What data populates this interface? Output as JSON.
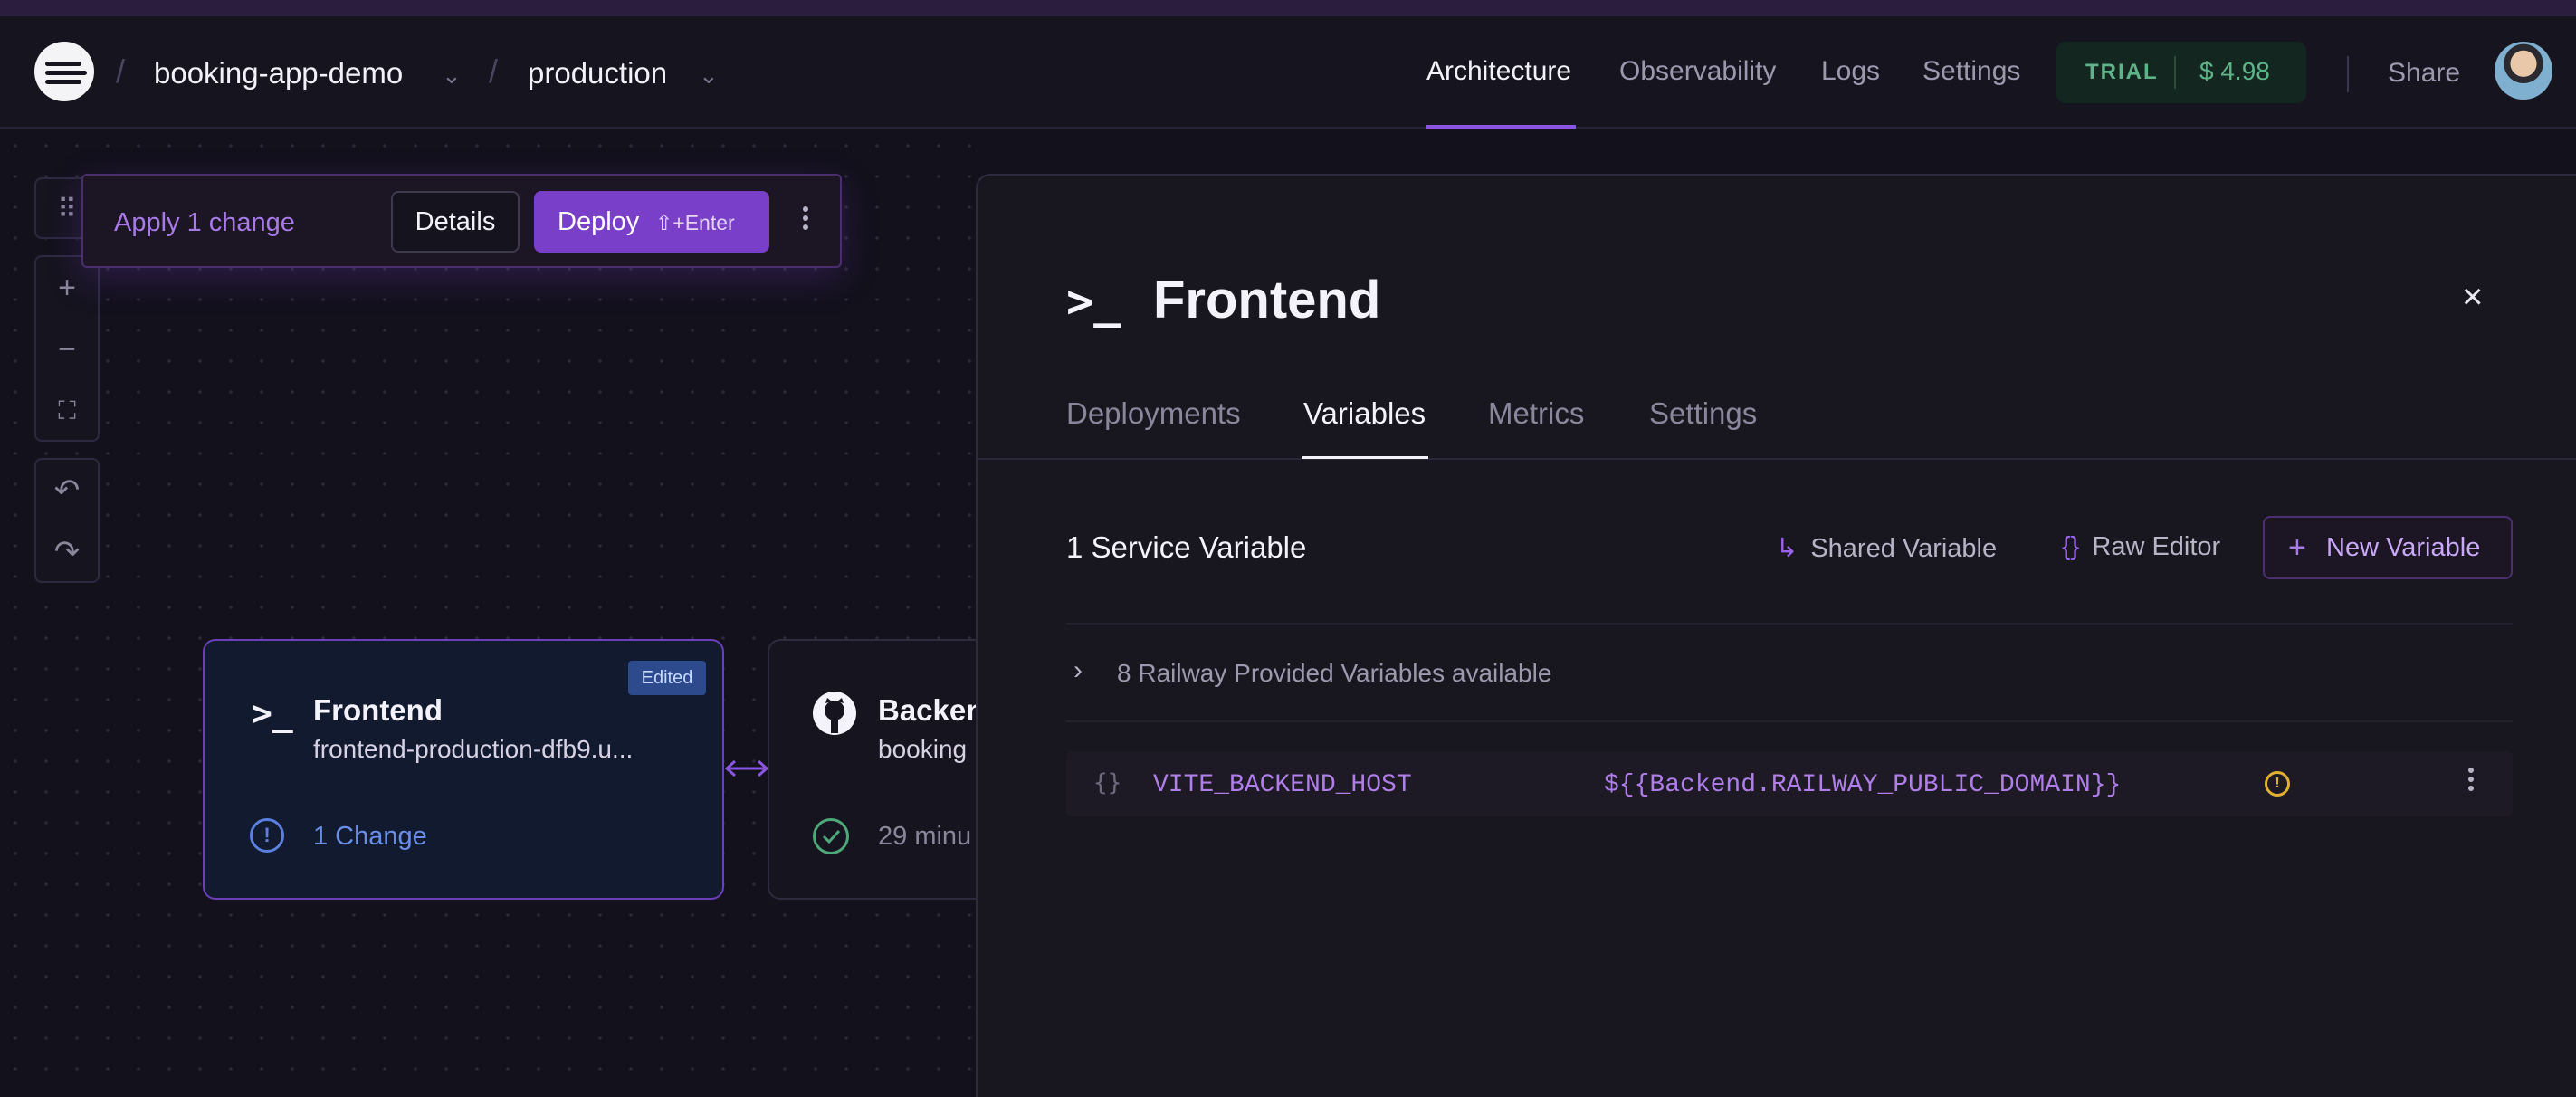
{
  "header": {
    "project": "booking-app-demo",
    "environment": "production",
    "separator": "/",
    "nav": [
      "Architecture",
      "Observability",
      "Logs",
      "Settings"
    ],
    "active_nav": "Architecture",
    "trial_label": "TRIAL",
    "trial_balance": "$ 4.98",
    "share": "Share"
  },
  "changes_bar": {
    "text": "Apply 1 change",
    "details": "Details",
    "deploy": "Deploy",
    "deploy_shortcut": "⇧+Enter"
  },
  "canvas": {
    "tools": {
      "grid": "⠿",
      "zoom_in": "+",
      "zoom_out": "−",
      "fit": "⛶",
      "undo": "↶",
      "redo": "↷"
    },
    "frontend_card": {
      "icon": ">_",
      "badge": "Edited",
      "title": "Frontend",
      "subtitle": "frontend-production-dfb9.u...",
      "change_icon": "!",
      "changes": "1 Change"
    },
    "backend_card": {
      "title": "Backen",
      "subtitle": "booking",
      "status": "29 minu"
    }
  },
  "panel": {
    "icon": ">_",
    "title": "Frontend",
    "close": "×",
    "tabs": [
      "Deployments",
      "Variables",
      "Metrics",
      "Settings"
    ],
    "active_tab": "Variables",
    "service_count": "1 Service Variable",
    "actions": {
      "shared_icon": "↳",
      "shared": "Shared Variable",
      "raw_icon": "{}",
      "raw": "Raw Editor",
      "new_icon": "+",
      "new": "New Variable"
    },
    "provided_chevron": "›",
    "provided": "8 Railway Provided Variables available",
    "variables": [
      {
        "icon": "{}",
        "name": "VITE_BACKEND_HOST",
        "value": "${{Backend.RAILWAY_PUBLIC_DOMAIN}}",
        "warn_icon": "!"
      }
    ]
  },
  "colors": {
    "accent": "#7a3fc9",
    "trial": "#5eb389",
    "info": "#5c80e0",
    "warning": "#e0b030"
  },
  "icons": [
    "railway-logo-icon",
    "chevron-down-icon",
    "terminal-icon",
    "github-icon",
    "check-circle-icon",
    "info-circle-icon",
    "close-icon",
    "warning-icon",
    "kebab-menu-icon"
  ]
}
